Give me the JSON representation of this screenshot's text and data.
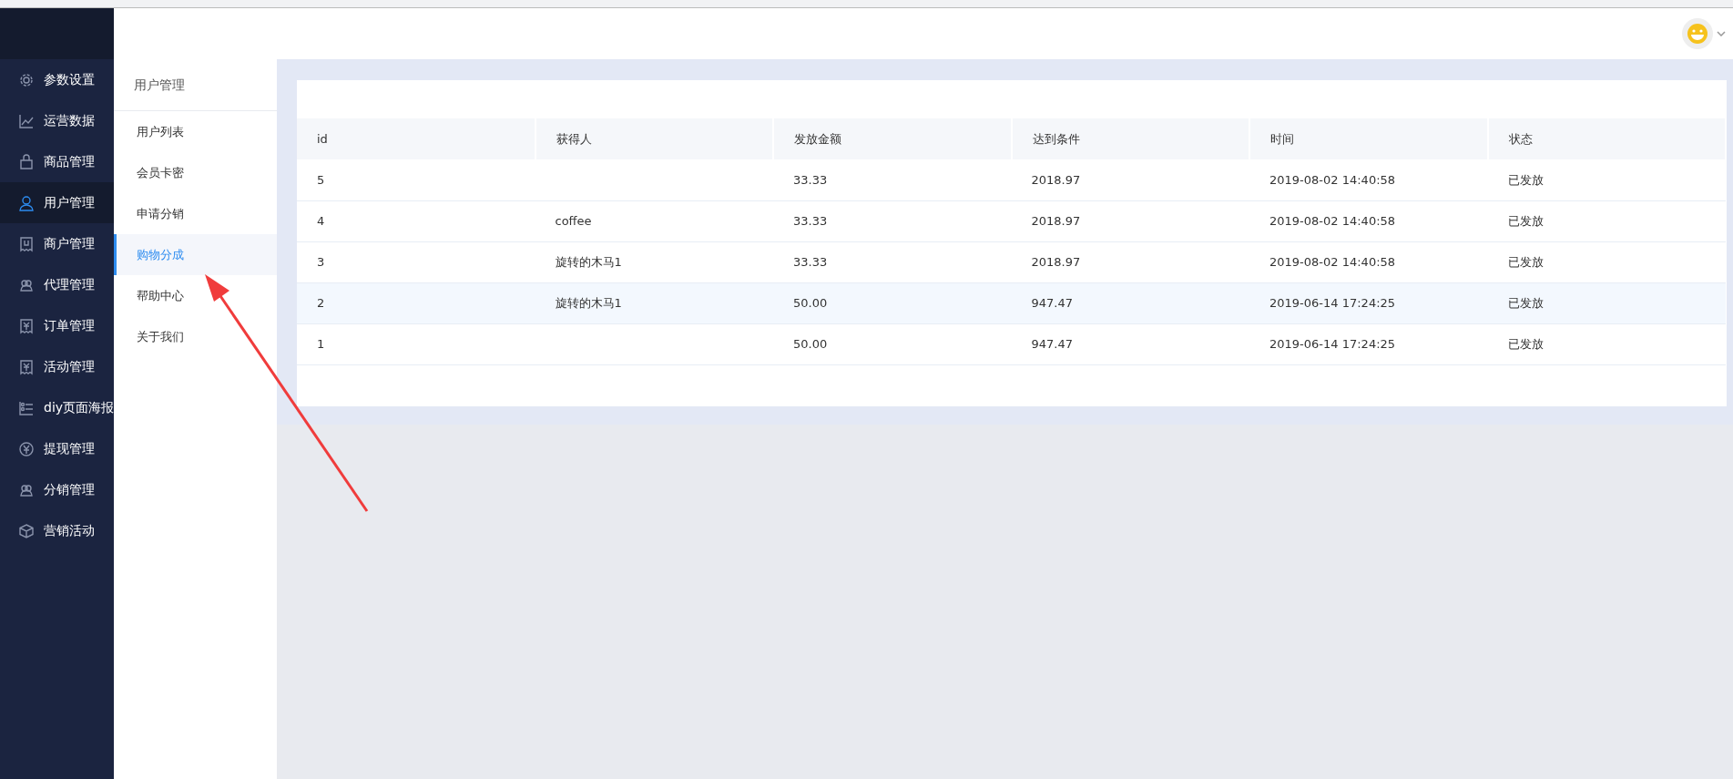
{
  "sidebar": {
    "items": [
      {
        "label": "参数设置",
        "selected": false
      },
      {
        "label": "运营数据",
        "selected": false
      },
      {
        "label": "商品管理",
        "selected": false
      },
      {
        "label": "用户管理",
        "selected": true
      },
      {
        "label": "商户管理",
        "selected": false
      },
      {
        "label": "代理管理",
        "selected": false
      },
      {
        "label": "订单管理",
        "selected": false
      },
      {
        "label": "活动管理",
        "selected": false
      },
      {
        "label": "diy页面海报",
        "selected": false
      },
      {
        "label": "提现管理",
        "selected": false
      },
      {
        "label": "分销管理",
        "selected": false
      },
      {
        "label": "营销活动",
        "selected": false
      }
    ]
  },
  "submenu": {
    "title": "用户管理",
    "items": [
      {
        "label": "用户列表",
        "selected": false
      },
      {
        "label": "会员卡密",
        "selected": false
      },
      {
        "label": "申请分销",
        "selected": false
      },
      {
        "label": "购物分成",
        "selected": true
      },
      {
        "label": "帮助中心",
        "selected": false
      },
      {
        "label": "关于我们",
        "selected": false
      }
    ]
  },
  "table": {
    "columns": [
      "id",
      "获得人",
      "发放金额",
      "达到条件",
      "时间",
      "状态"
    ],
    "rows": [
      {
        "cells": [
          "5",
          "",
          "33.33",
          "2018.97",
          "2019-08-02 14:40:58",
          "已发放"
        ],
        "hovered": false
      },
      {
        "cells": [
          "4",
          "coffee",
          "33.33",
          "2018.97",
          "2019-08-02 14:40:58",
          "已发放"
        ],
        "hovered": false
      },
      {
        "cells": [
          "3",
          "旋转的木马1",
          "33.33",
          "2018.97",
          "2019-08-02 14:40:58",
          "已发放"
        ],
        "hovered": false
      },
      {
        "cells": [
          "2",
          "旋转的木马1",
          "50.00",
          "947.47",
          "2019-06-14 17:24:25",
          "已发放"
        ],
        "hovered": true
      },
      {
        "cells": [
          "1",
          "",
          "50.00",
          "947.47",
          "2019-06-14 17:24:25",
          "已发放"
        ],
        "hovered": false
      }
    ]
  }
}
